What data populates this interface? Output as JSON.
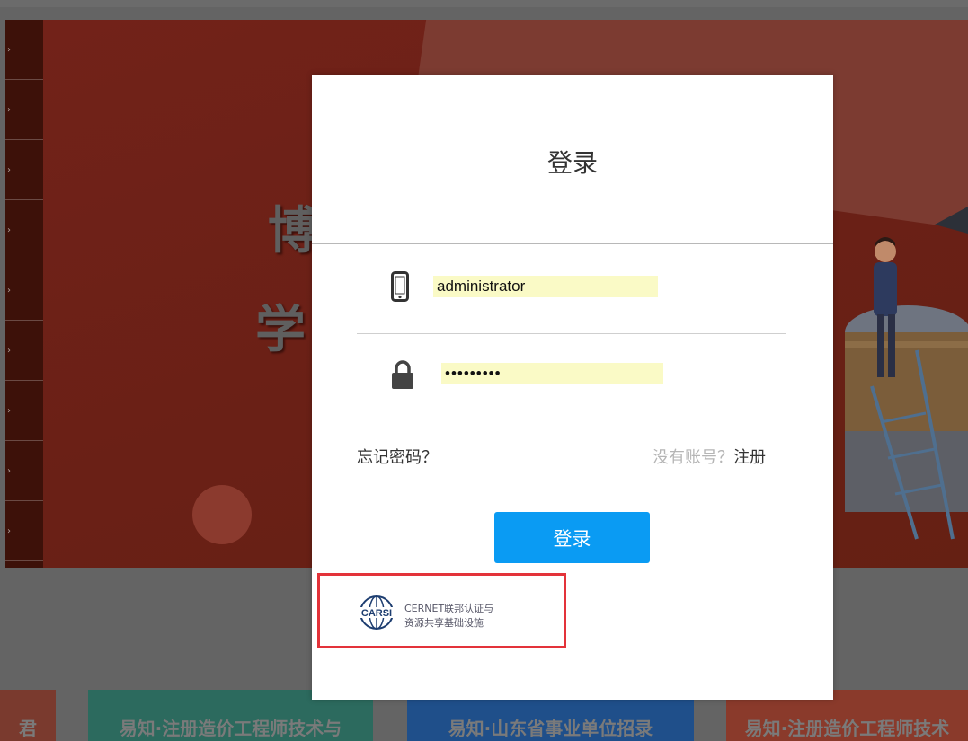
{
  "hero": {
    "line1": "博",
    "line2": "学"
  },
  "cards": [
    {
      "label": "君"
    },
    {
      "label": "易知·注册造价工程师技术与"
    },
    {
      "label": "易知·山东省事业单位招录"
    },
    {
      "label": "易知·注册造价工程师技术"
    }
  ],
  "colors": {
    "accent": "#0a9bf3",
    "highlight_border": "#e3333a",
    "autofill": "#fafac6"
  },
  "login_modal": {
    "title": "登录",
    "username": {
      "icon": "phone-icon",
      "value": "administrator"
    },
    "password": {
      "icon": "lock-icon",
      "value": "•••••••••"
    },
    "forgot_password": "忘记密码？",
    "no_account": "没有账号？",
    "register": "注册",
    "submit": "登录",
    "carsi": {
      "logo_text": "CARSI",
      "line1": "CERNET联邦认证与",
      "line2": "资源共享基础设施"
    }
  }
}
